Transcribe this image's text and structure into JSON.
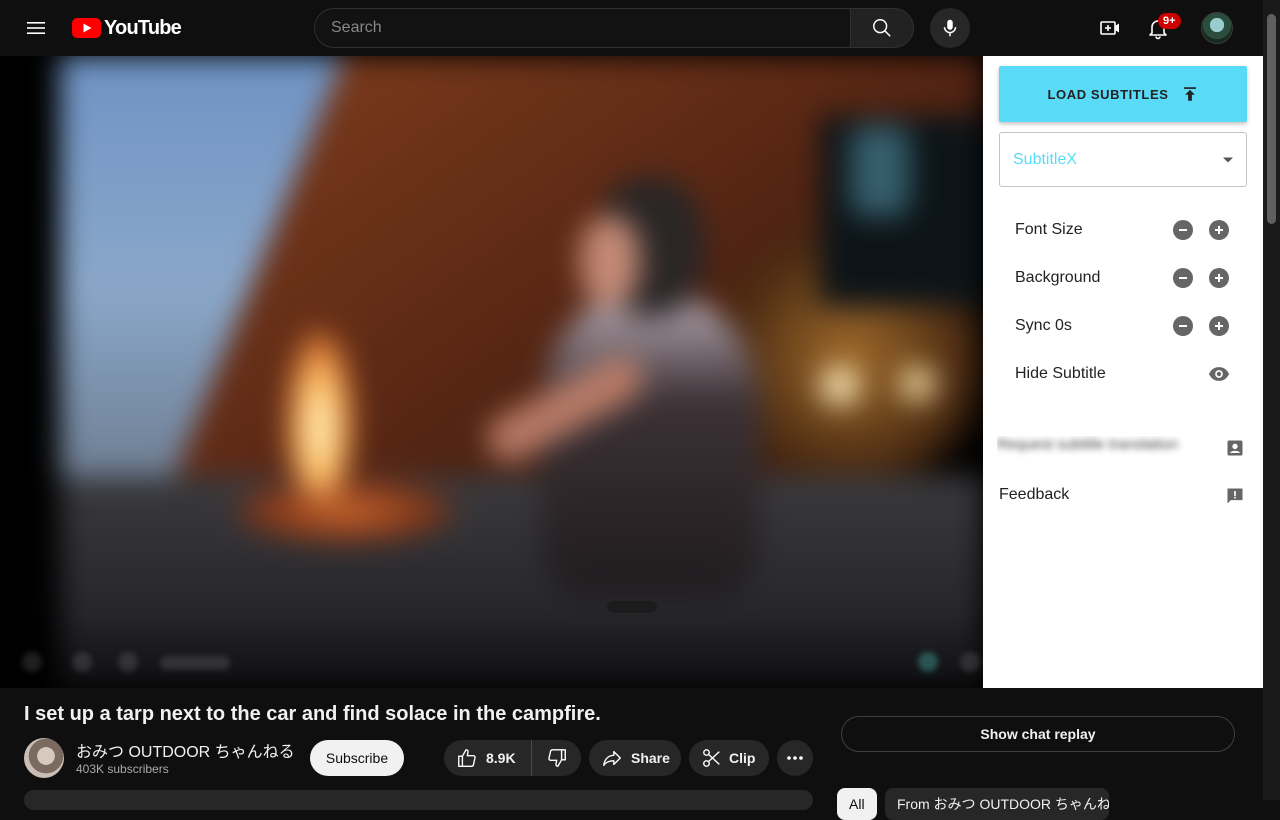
{
  "masthead": {
    "logo_text": "YouTube",
    "search_placeholder": "Search",
    "notification_badge": "9+"
  },
  "icons": {
    "menu": "hamburger-icon",
    "search": "search-icon",
    "mic": "microphone-icon",
    "create": "create-video-icon",
    "notifications": "bell-icon",
    "upload": "upload-arrow-icon",
    "dropdown": "caret-down-icon",
    "minus": "minus-circle-icon",
    "plus": "plus-circle-icon",
    "eye": "eye-icon",
    "contact": "contact-card-icon",
    "feedback": "feedback-icon",
    "like": "thumb-up-icon",
    "dislike": "thumb-down-icon",
    "share": "share-icon",
    "clip": "scissors-icon",
    "more": "more-horizontal-icon"
  },
  "subtitle_panel": {
    "load_button": "LOAD SUBTITLES",
    "selected_source": "SubtitleX",
    "settings": [
      {
        "label": "Font Size"
      },
      {
        "label": "Background"
      },
      {
        "label": "Sync 0s"
      },
      {
        "label": "Hide Subtitle"
      }
    ],
    "blurred_item": "Request subtitle translation",
    "feedback_label": "Feedback"
  },
  "video": {
    "title": "I set up a tarp next to the car and find solace in the campfire.",
    "channel_name": "おみつ OUTDOOR ちゃんねる",
    "subscriber_count": "403K subscribers",
    "subscribe_label": "Subscribe",
    "like_count": "8.9K",
    "share_label": "Share",
    "clip_label": "Clip"
  },
  "chat": {
    "replay_label": "Show chat replay"
  },
  "chips": {
    "all": "All",
    "from_channel": "From おみつ OUTDOOR ちゃんねる"
  },
  "colors": {
    "background": "#0f0f0f",
    "accent_cyan": "#59dbf8",
    "youtube_red": "#ff0000",
    "badge_red": "#cc0000",
    "panel_bg": "#ffffff",
    "button_dark": "#272727"
  }
}
